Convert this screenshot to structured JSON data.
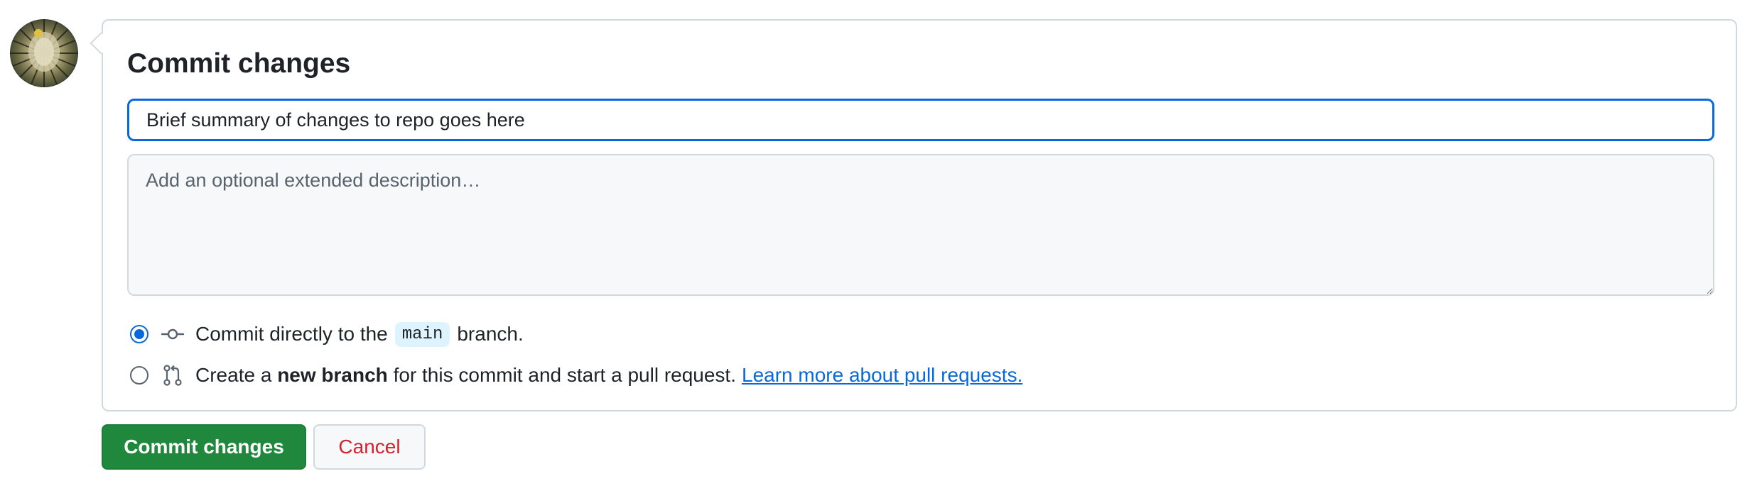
{
  "panel": {
    "title": "Commit changes"
  },
  "summary": {
    "value": "Brief summary of changes to repo goes here",
    "placeholder": ""
  },
  "description": {
    "placeholder": "Add an optional extended description…"
  },
  "options": {
    "direct": {
      "prefix": "Commit directly to the",
      "branch": "main",
      "suffix": "branch.",
      "selected": true,
      "icon": "git-commit-icon"
    },
    "new_branch": {
      "prefix": "Create a",
      "bold": "new branch",
      "suffix": "for this commit and start a pull request.",
      "link": "Learn more about pull requests.",
      "selected": false,
      "icon": "git-pull-request-icon"
    }
  },
  "buttons": {
    "commit_label": "Commit changes",
    "cancel_label": "Cancel"
  },
  "colors": {
    "primary_button": "#1f883d",
    "accent": "#0969da",
    "danger_text": "#d1242f",
    "border": "#d1d9e0"
  }
}
